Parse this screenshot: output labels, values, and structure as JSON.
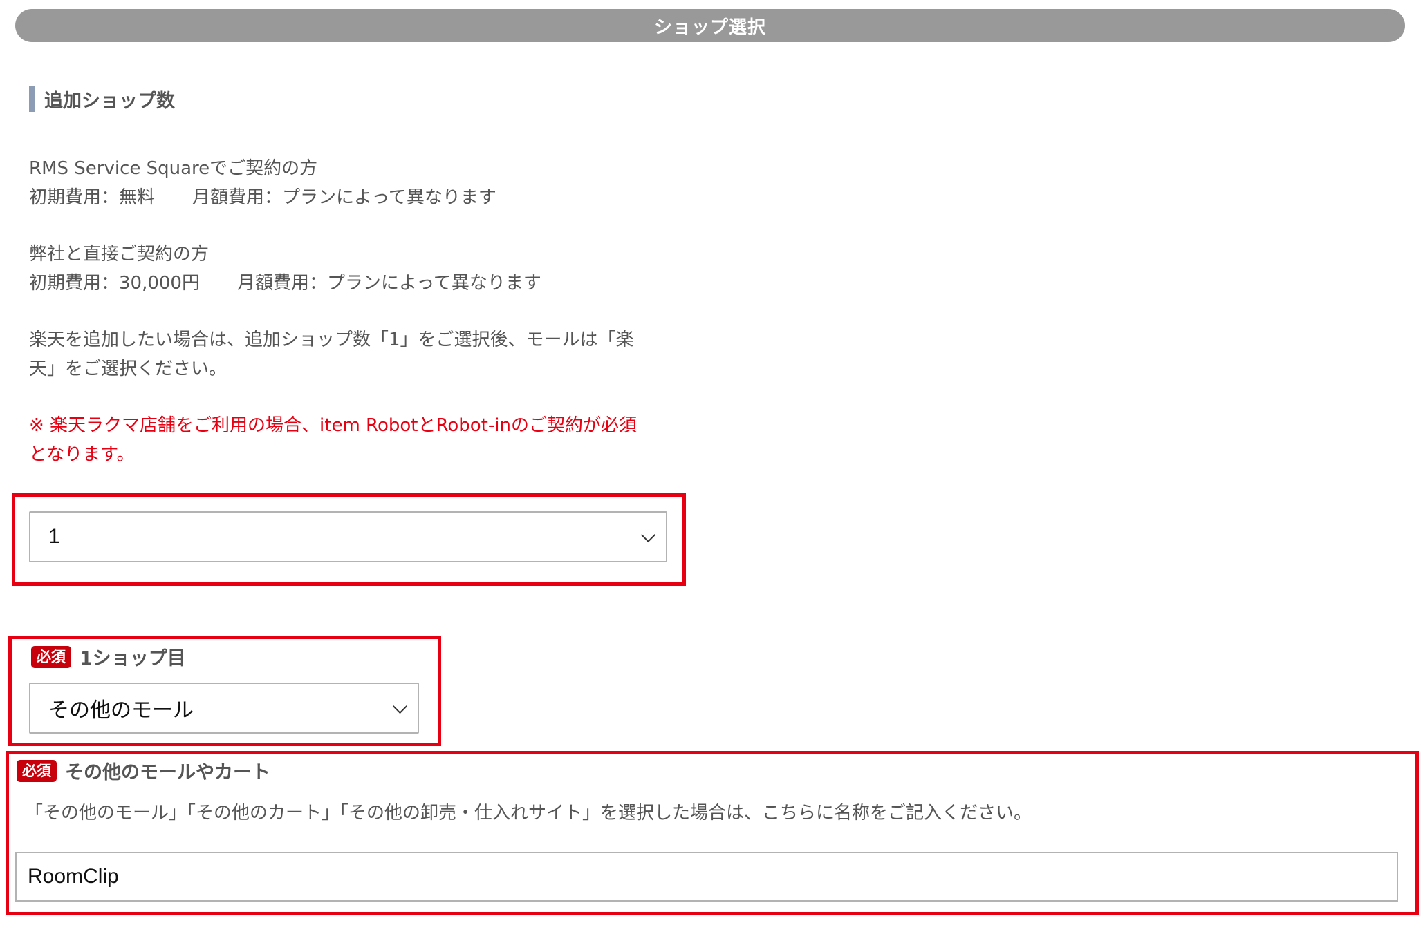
{
  "header": {
    "title": "ショップ選択"
  },
  "section": {
    "title": "追加ショップ数"
  },
  "info": {
    "rms_label": "RMS Service Squareでご契約の方",
    "rms_initial": "初期費用：無料",
    "rms_monthly": "月額費用：プランによって異なります",
    "direct_label": "弊社と直接ご契約の方",
    "direct_initial": "初期費用：30,000円",
    "direct_monthly": "月額費用：プランによって異なります",
    "rakuten_line1": "楽天を追加したい場合は、追加ショップ数「1」をご選択後、モールは「楽",
    "rakuten_line2": "天」をご選択ください。",
    "note_line1": "※ 楽天ラクマ店舗をご利用の場合、item RobotとRobot-inのご契約が必須",
    "note_line2": "となります。"
  },
  "shop_count_select": {
    "value": "1"
  },
  "shop1": {
    "badge": "必須",
    "label": "1ショップ目",
    "select_value": "その他のモール"
  },
  "other_mall": {
    "badge": "必須",
    "label": "その他のモールやカート",
    "description": "「その他のモール」「その他のカート」「その他の卸売・仕入れサイト」を選択した場合は、こちらに名称をご記入ください。",
    "input_value": "RoomClip"
  },
  "colors": {
    "header_bg": "#999999",
    "required_badge": "#c8000b",
    "highlight_border": "#e60012",
    "note_text": "#e60012"
  }
}
